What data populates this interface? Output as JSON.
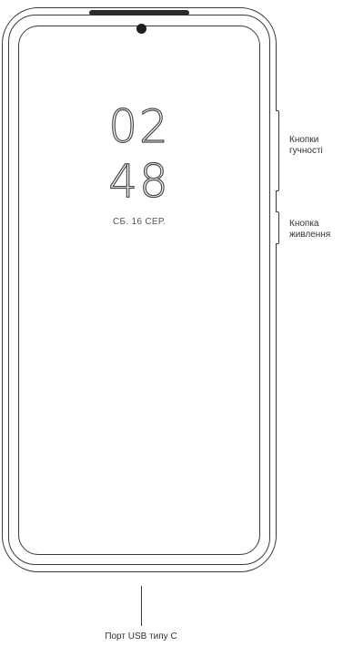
{
  "phone": {
    "clock_hours": "02",
    "clock_minutes": "48",
    "date": "СБ. 16 СЕР."
  },
  "labels": {
    "volume_line1": "Кнопки",
    "volume_line2": "гучності",
    "power_line1": "Кнопка",
    "power_line2": "живлення",
    "usb_port": "Порт USB типу C"
  }
}
